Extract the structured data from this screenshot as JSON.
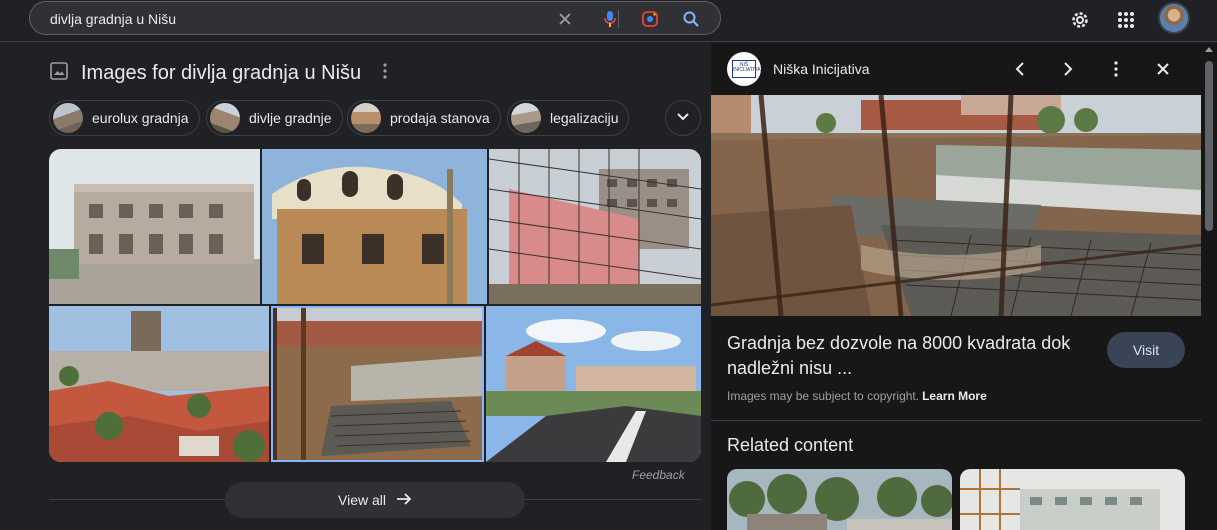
{
  "search": {
    "query": "divlja gradnja u Nišu"
  },
  "images_section": {
    "title": "Images for divlja gradnja u Nišu",
    "chips": [
      {
        "label": "eurolux gradnja"
      },
      {
        "label": "divlje gradnje"
      },
      {
        "label": "prodaja stanova"
      },
      {
        "label": "legalizaciju"
      }
    ],
    "feedback_label": "Feedback",
    "view_all_label": "View all"
  },
  "preview_panel": {
    "source_name": "Niška Inicijativa",
    "logo_text": "NIŠ INICIJATIVA",
    "title": "Gradnja bez dozvole na 8000 kvadrata dok nadležni nisu ...",
    "visit_label": "Visit",
    "copyright_text": "Images may be subject to copyright.",
    "learn_more_label": "Learn More",
    "related_heading": "Related content"
  },
  "colors": {
    "background": "#202124",
    "panel": "#171717",
    "accent_blue": "#8ab4f8",
    "visit_button": "#394457"
  },
  "icons": [
    "clear-icon",
    "mic-icon",
    "lens-icon",
    "search-icon",
    "settings-gear-icon",
    "apps-grid-icon",
    "image-icon",
    "more-vert-icon",
    "chevron-down-icon",
    "arrow-right-icon",
    "chevron-left-icon",
    "chevron-right-icon",
    "close-icon"
  ]
}
